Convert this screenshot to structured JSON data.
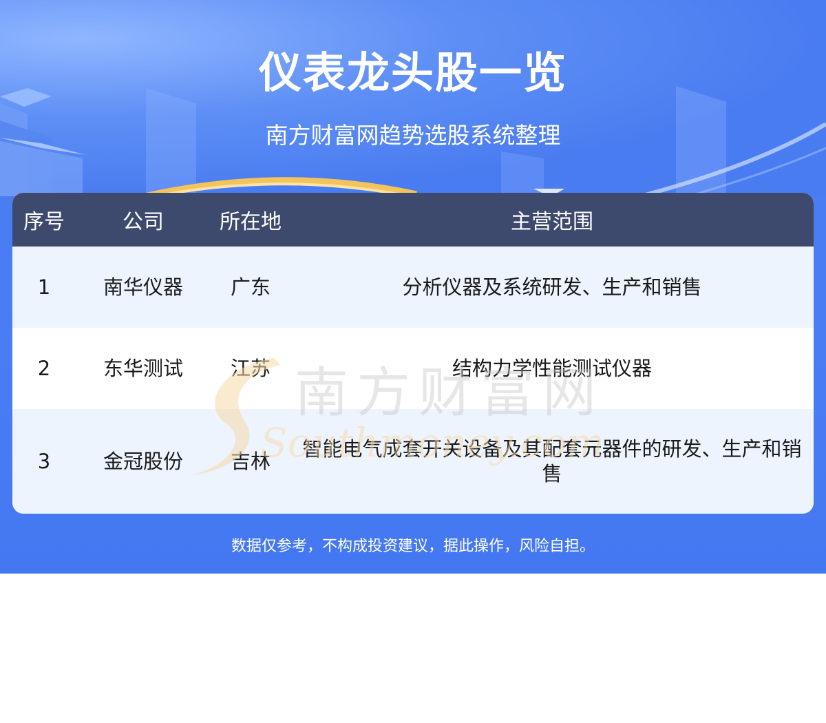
{
  "header": {
    "title": "仪表龙头股一览",
    "subtitle": "南方财富网趋势选股系统整理"
  },
  "table": {
    "columns": [
      "序号",
      "公司",
      "所在地",
      "主营范围"
    ],
    "rows": [
      {
        "index": "1",
        "company": "南华仪器",
        "location": "广东",
        "business": "分析仪器及系统研发、生产和销售"
      },
      {
        "index": "2",
        "company": "东华测试",
        "location": "江苏",
        "business": "结构力学性能测试仪器"
      },
      {
        "index": "3",
        "company": "金冠股份",
        "location": "吉林",
        "business": "智能电气成套开关设备及其配套元器件的研发、生产和销售"
      }
    ]
  },
  "watermark": {
    "text": "南方财富网",
    "latin": "Southmoney.com"
  },
  "footer": {
    "disclaimer": "数据仅参考，不构成投资建议，据此操作，风险自担。"
  },
  "colors": {
    "background": "#4a7df4",
    "header_row": "#3e4a6d",
    "row_alt": "#eef4fe",
    "row_white": "#ffffff",
    "arc_gold": "#f4c35a"
  }
}
